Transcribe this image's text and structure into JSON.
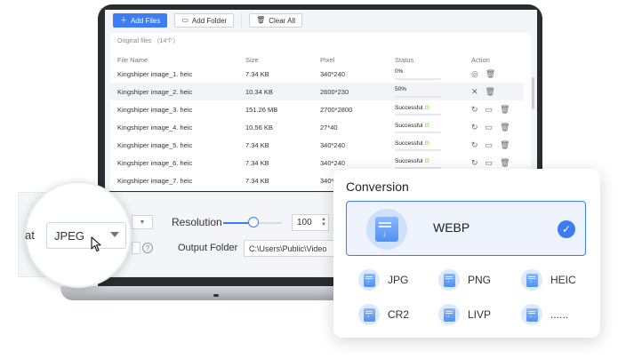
{
  "toolbar": {
    "add_files": "Add Files",
    "add_folder": "Add Folder",
    "clear_all": "Clear All"
  },
  "list": {
    "heading": "Original files （14个）",
    "columns": [
      "File Name",
      "Size",
      "Pixel",
      "Status",
      "Action"
    ],
    "rows": [
      {
        "name": "Kingshiper image_1. heic",
        "size": "7.34 KB",
        "pixel": "340*240",
        "status": "0%",
        "progress": 0
      },
      {
        "name": "Kingshiper image_2. heic",
        "size": "10.34 KB",
        "pixel": "2600*230",
        "status": "50%",
        "progress": 0.5
      },
      {
        "name": "Kingshiper image_3. heic",
        "size": "151.26 MB",
        "pixel": "2700*2800",
        "status": "Successful",
        "progress": 1
      },
      {
        "name": "Kingshiper image_4. heic",
        "size": "10.56 KB",
        "pixel": "27*40",
        "status": "Successful",
        "progress": 1
      },
      {
        "name": "Kingshiper image_5. heic",
        "size": "7.34 KB",
        "pixel": "340*240",
        "status": "Successful",
        "progress": 1
      },
      {
        "name": "Kingshiper image_6. heic",
        "size": "7.34 KB",
        "pixel": "340*240",
        "status": "Successful",
        "progress": 1
      },
      {
        "name": "Kingshiper image_7. heic",
        "size": "7.34 KB",
        "pixel": "340*240",
        "status": "",
        "progress": 0
      }
    ]
  },
  "settings": {
    "format_label": "at",
    "format_value": "JPEG",
    "resolution_label": "Resolution",
    "resolution_value": "100",
    "output_label": "Output Folder",
    "output_path": "C:\\Users\\Public\\Video"
  },
  "conversion": {
    "title": "Conversion",
    "selected": "WEBP",
    "formats": [
      "JPG",
      "PNG",
      "HEIC",
      "CR2",
      "LIVP",
      "......"
    ]
  },
  "colors": {
    "accent": "#3d7cf4",
    "success": "#52c41a"
  }
}
